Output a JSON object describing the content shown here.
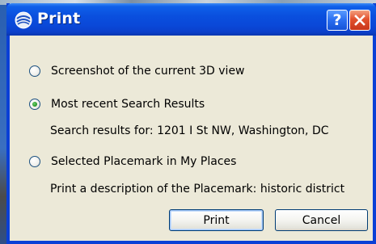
{
  "dialog": {
    "title": "Print",
    "help_label": "?",
    "close_label": "✕"
  },
  "options": [
    {
      "label": "Screenshot of the current 3D view",
      "selected": false
    },
    {
      "label": "Most recent Search Results",
      "selected": true,
      "description": "Search results for: 1201 I St NW, Washington, DC"
    },
    {
      "label": "Selected Placemark in My Places",
      "selected": false,
      "description": "Print a description of the Placemark: historic district"
    }
  ],
  "buttons": {
    "print_label": "Print",
    "cancel_label": "Cancel"
  },
  "colors": {
    "titlebar": "#0a4fde",
    "dialog_bg": "#ece9d8",
    "radio_dot": "#2a9a2a"
  }
}
